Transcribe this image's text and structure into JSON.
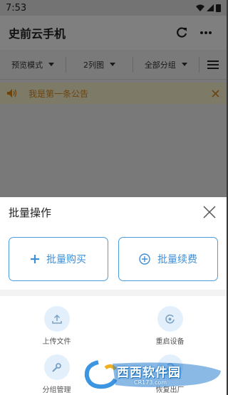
{
  "status_bar": {
    "time": "7:53"
  },
  "app_bar": {
    "title": "史前云手机"
  },
  "filters": [
    {
      "label": "预览模式"
    },
    {
      "label": "2列图"
    },
    {
      "label": "全部分组"
    }
  ],
  "notice": {
    "text": "我是第一条公告"
  },
  "sheet": {
    "title": "批量操作",
    "buy_label": "批量购买",
    "renew_label": "批量续费",
    "actions": [
      {
        "label": "上传文件",
        "icon": "upload-icon"
      },
      {
        "label": "重启设备",
        "icon": "restart-icon"
      },
      {
        "label": "分组管理",
        "icon": "wrench-icon"
      },
      {
        "label": "恢复出厂",
        "icon": "reset-icon"
      }
    ]
  },
  "watermark": {
    "text": "西西软件园",
    "sub": "CR173.com"
  },
  "colors": {
    "accent": "#3d8fd6",
    "notice_text": "#d88a1a",
    "notice_bg": "#fdf5d0"
  }
}
